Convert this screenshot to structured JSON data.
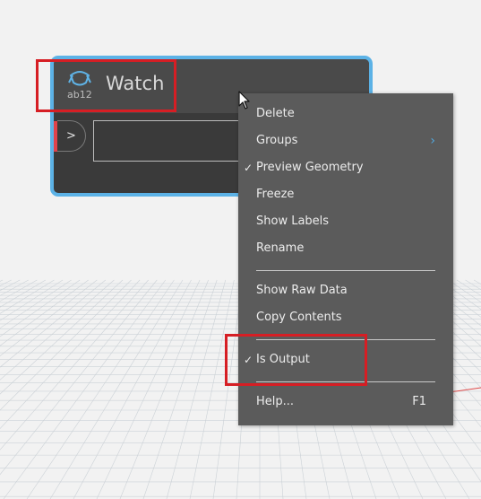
{
  "node": {
    "title": "Watch",
    "icon": "watch-ab12-icon",
    "icon_text": "ab12",
    "input_port_label": ">",
    "accent_color": "#5cb2e6",
    "port_marker_color": "#e0434b"
  },
  "context_menu": {
    "items": [
      {
        "label": "Delete",
        "checked": false
      },
      {
        "label": "Groups",
        "has_submenu": true,
        "submenu_icon": "chevron-right-icon"
      },
      {
        "label": "Preview Geometry",
        "checked": true
      },
      {
        "label": "Freeze",
        "checked": false
      },
      {
        "label": "Show Labels",
        "checked": false
      },
      {
        "label": "Rename",
        "checked": false
      },
      {
        "label": "Show Raw Data",
        "checked": false
      },
      {
        "label": "Copy Contents",
        "checked": false
      },
      {
        "label": "Is Output",
        "checked": true
      },
      {
        "label": "Help...",
        "shortcut": "F1"
      }
    ],
    "check_glyph": "✓",
    "submenu_glyph": "›"
  },
  "colors": {
    "menu_background": "#5b5b5b",
    "highlight": "#d61e24",
    "grid_line": "#c8ced4",
    "background": "#f2f2f2"
  }
}
